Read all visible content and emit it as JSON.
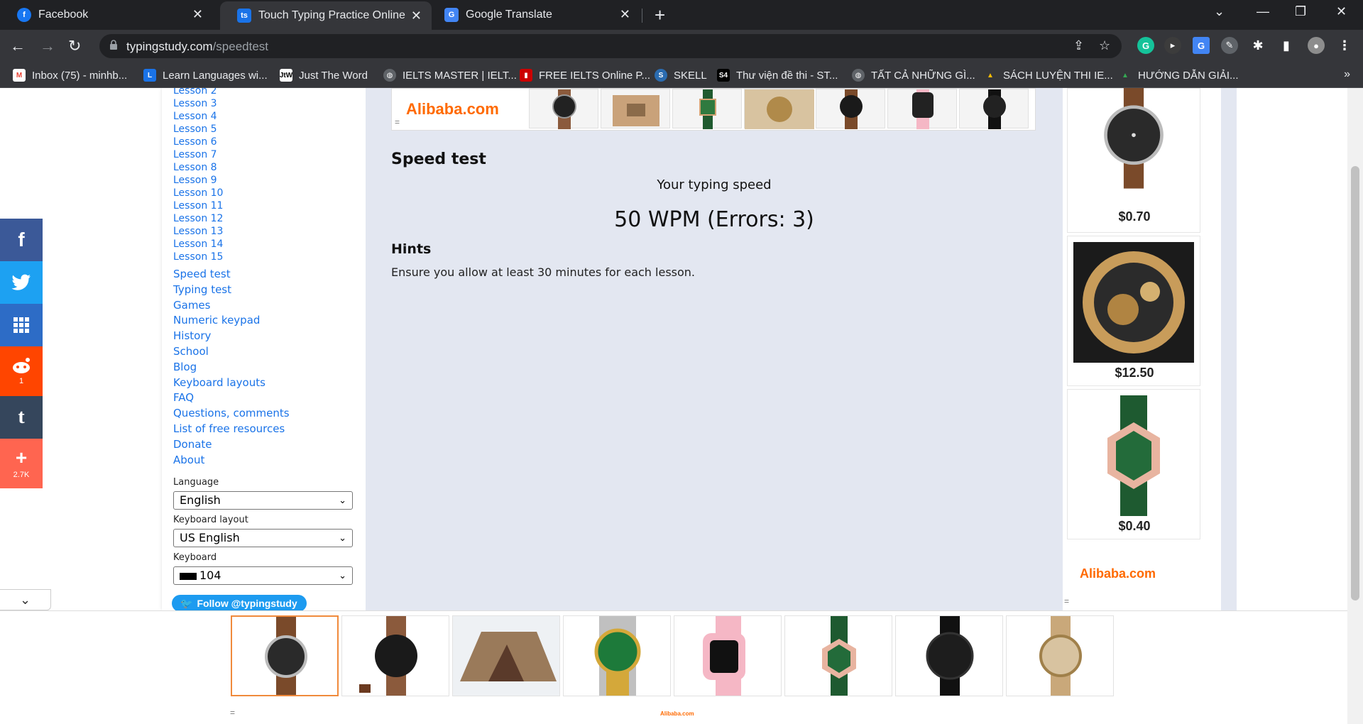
{
  "browser": {
    "tabs": [
      {
        "title": "Facebook",
        "icon": "facebook-icon"
      },
      {
        "title": "Touch Typing Practice Online",
        "icon": "typingstudy-icon",
        "active": true
      },
      {
        "title": "Google Translate",
        "icon": "google-translate-icon"
      }
    ],
    "url_host": "typingstudy.com",
    "url_path": "/speedtest",
    "bookmarks": [
      {
        "label": "Inbox (75) - minhb...",
        "icon": "gmail-icon"
      },
      {
        "label": "Learn Languages wi...",
        "icon": "learn-languages-icon"
      },
      {
        "label": "Just The Word",
        "icon": "jtw-icon"
      },
      {
        "label": "IELTS MASTER | IELT...",
        "icon": "globe-icon"
      },
      {
        "label": "FREE IELTS Online P...",
        "icon": "ielts-online-icon"
      },
      {
        "label": "SKELL",
        "icon": "skell-icon"
      },
      {
        "label": "Thư viện đề thi - ST...",
        "icon": "s4-icon"
      },
      {
        "label": "TẤT CẢ NHỮNG GÌ...",
        "icon": "globe-icon"
      },
      {
        "label": "SÁCH LUYỆN THI IE...",
        "icon": "google-drive-icon"
      },
      {
        "label": "HƯỚNG DẪN GIẢI...",
        "icon": "google-drive-icon"
      }
    ]
  },
  "sidebar": {
    "lessons": [
      "Lesson 2",
      "Lesson 3",
      "Lesson 4",
      "Lesson 5",
      "Lesson 6",
      "Lesson 7",
      "Lesson 8",
      "Lesson 9",
      "Lesson 10",
      "Lesson 11",
      "Lesson 12",
      "Lesson 13",
      "Lesson 14",
      "Lesson 15"
    ],
    "links": [
      "Speed test",
      "Typing test",
      "Games",
      "Numeric keypad",
      "History",
      "School",
      "Blog",
      "Keyboard layouts",
      "FAQ",
      "Questions, comments",
      "List of free resources",
      "Donate",
      "About"
    ],
    "language_label": "Language",
    "language_value": "English",
    "layout_label": "Keyboard layout",
    "layout_value": "US English",
    "keyboard_label": "Keyboard",
    "keyboard_value": "104",
    "follow_label": "Follow @typingstudy"
  },
  "main": {
    "heading": "Speed test",
    "typing_label": "Your typing speed",
    "result": "50 WPM (Errors: 3)",
    "hints_heading": "Hints",
    "hint_text": "Ensure you allow at least 30 minutes for each lesson."
  },
  "ads": {
    "brand": "Alibaba.com",
    "right_prices": [
      "$0.70",
      "$12.50",
      "$0.40"
    ]
  },
  "social": {
    "buttons": [
      {
        "name": "facebook",
        "glyph": "f",
        "color": "#3b5998",
        "count": ""
      },
      {
        "name": "twitter",
        "glyph": "🐦",
        "color": "#1da1f2",
        "count": ""
      },
      {
        "name": "apps",
        "glyph": "⋮⋮⋮",
        "color": "#2d6cc6",
        "count": ""
      },
      {
        "name": "reddit",
        "glyph": "👽",
        "color": "#ff4500",
        "count": "1"
      },
      {
        "name": "tumblr",
        "glyph": "t",
        "color": "#35465c",
        "count": ""
      },
      {
        "name": "more",
        "glyph": "+",
        "color": "#ff6550",
        "count": "2.7K"
      }
    ]
  }
}
